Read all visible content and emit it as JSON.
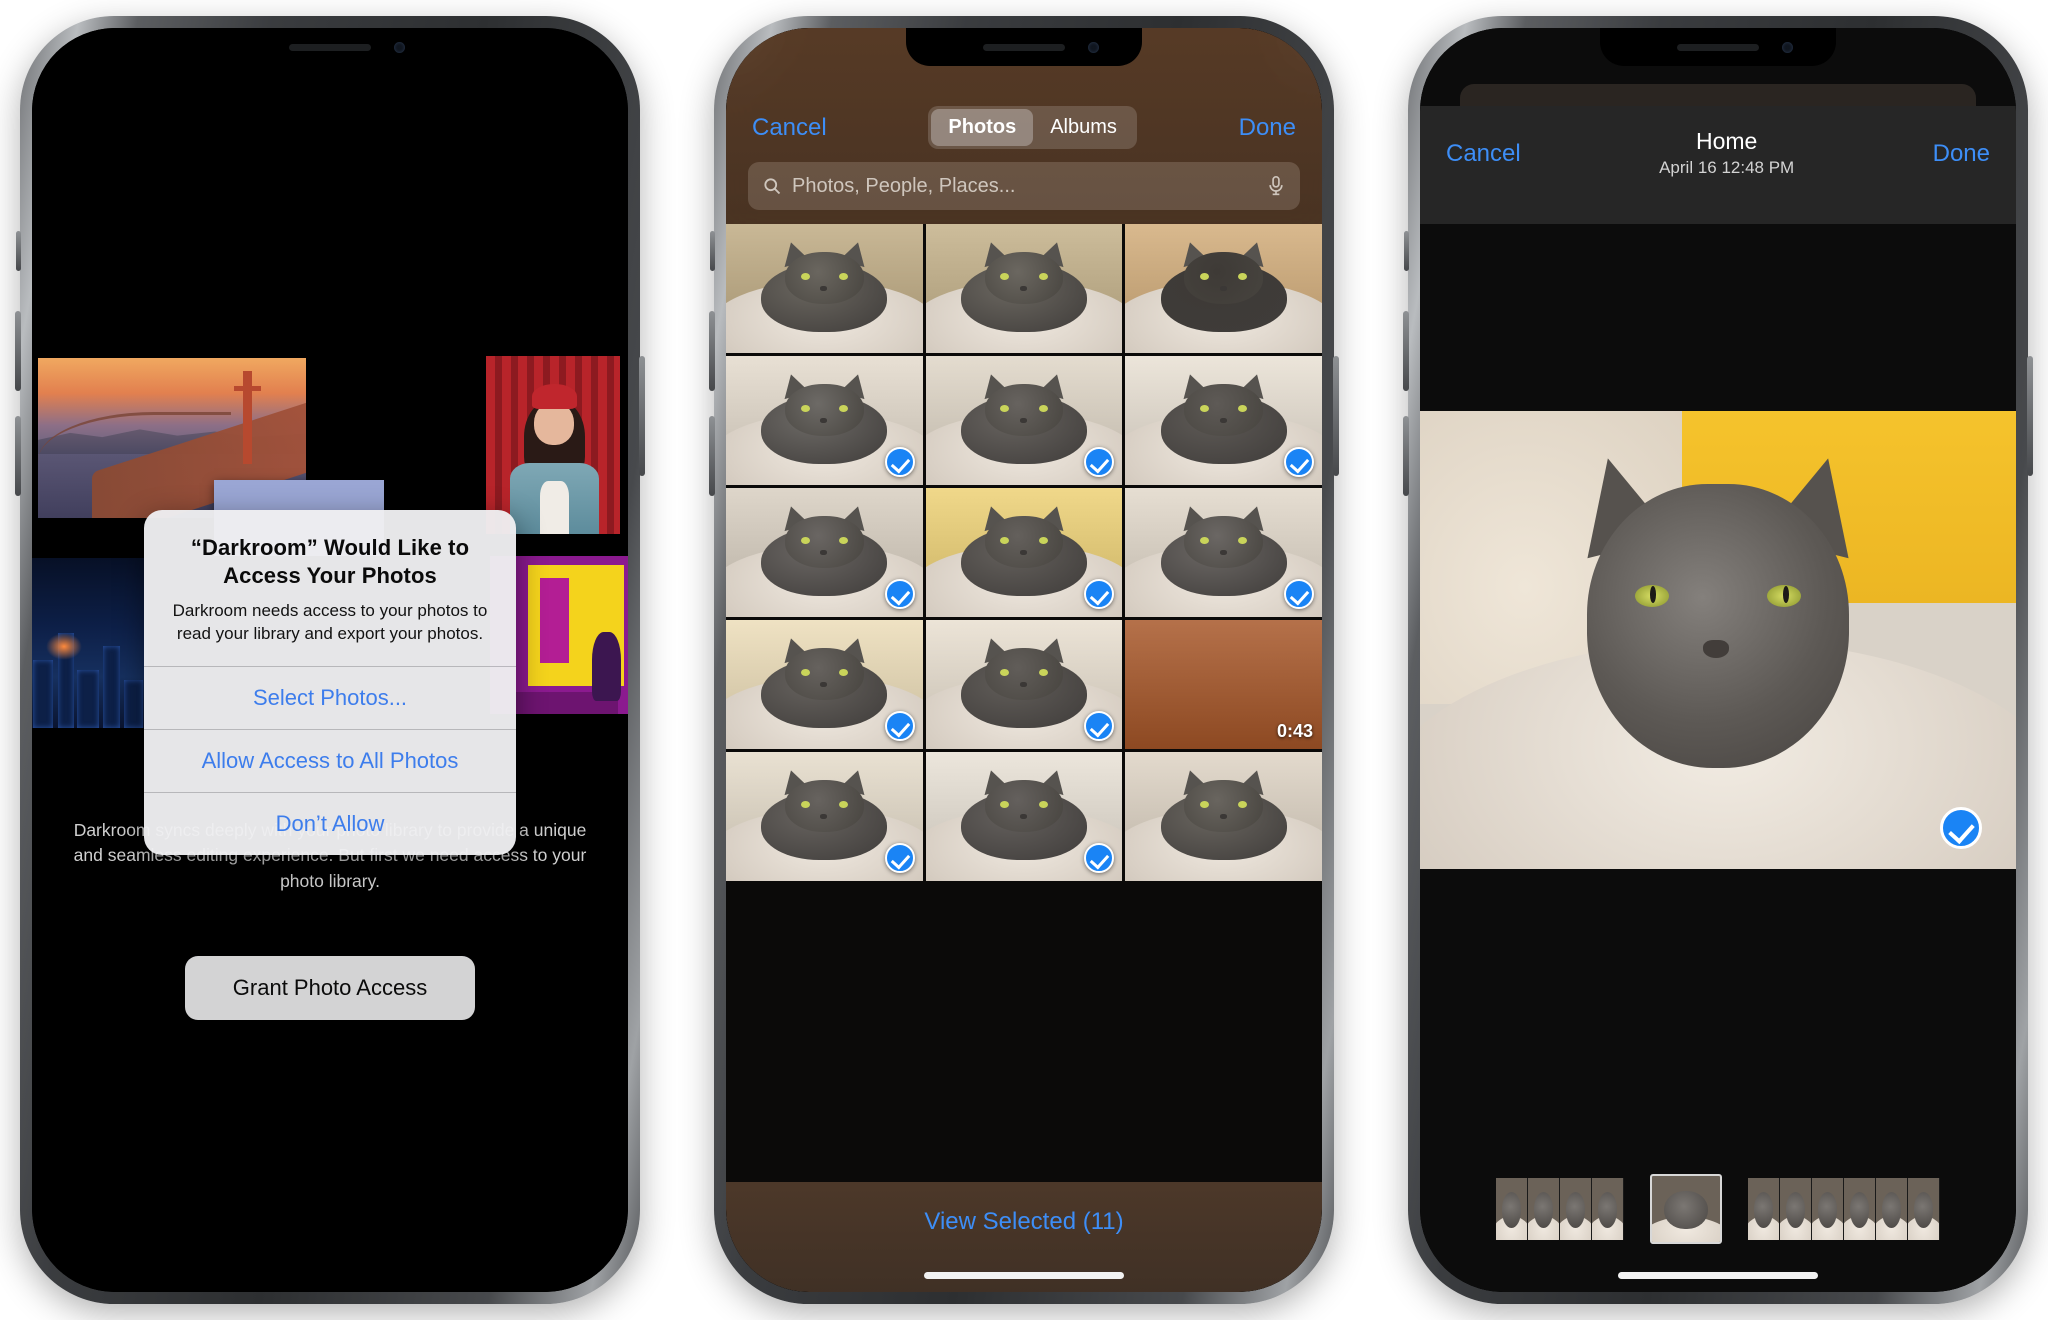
{
  "phone1": {
    "name": "permission-prompt-screen",
    "alert": {
      "title": "“Darkroom” Would Like to Access Your Photos",
      "message": "Darkroom needs access to your photos to read your library and export your photos.",
      "actions": [
        {
          "label": "Select Photos...",
          "style": "normal"
        },
        {
          "label": "Allow Access to All Photos",
          "style": "normal"
        },
        {
          "label": "Don’t Allow",
          "style": "normal"
        }
      ]
    },
    "body_copy": "Darkroom syncs deeply with your photo library to provide a unique and seamless editing experience. But first we need access to your photo library.",
    "cta_label": "Grant Photo Access",
    "collage": [
      {
        "name": "golden-gate-bridge-photo"
      },
      {
        "name": "red-beanie-portrait-photo"
      },
      {
        "name": "blue-card-placeholder"
      },
      {
        "name": "city-night-skyline-photo"
      },
      {
        "name": "pop-art-street-photo"
      }
    ]
  },
  "phone2": {
    "name": "limited-photo-picker-screen",
    "nav": {
      "cancel_label": "Cancel",
      "done_label": "Done",
      "segments": [
        {
          "label": "Photos",
          "selected": true
        },
        {
          "label": "Albums",
          "selected": false
        }
      ]
    },
    "search": {
      "placeholder": "Photos, People, Places...",
      "value": "",
      "search_icon": "search-icon",
      "mic_icon": "microphone-icon"
    },
    "footer": {
      "label": "View Selected (11)",
      "selected_count": 11
    },
    "grid": [
      {
        "id": 1,
        "selected": false,
        "kind": "photo",
        "alt": "cat on windowsill"
      },
      {
        "id": 2,
        "selected": false,
        "kind": "photo",
        "alt": "cat on windowsill"
      },
      {
        "id": 3,
        "selected": false,
        "kind": "photo",
        "alt": "cat lying on tan rug"
      },
      {
        "id": 4,
        "selected": true,
        "kind": "photo",
        "alt": "cat with paw on fluffy bed"
      },
      {
        "id": 5,
        "selected": true,
        "kind": "photo",
        "alt": "cat stretched on fluffy bed"
      },
      {
        "id": 6,
        "selected": true,
        "kind": "photo",
        "alt": "cat curled in donut bed"
      },
      {
        "id": 7,
        "selected": true,
        "kind": "photo",
        "alt": "cat resting head on bed"
      },
      {
        "id": 8,
        "selected": true,
        "kind": "photo",
        "alt": "cat facing camera in bed"
      },
      {
        "id": 9,
        "selected": true,
        "kind": "photo",
        "alt": "cat lying in bed side view"
      },
      {
        "id": 10,
        "selected": true,
        "kind": "photo",
        "alt": "cat sitting in bed"
      },
      {
        "id": 11,
        "selected": true,
        "kind": "photo",
        "alt": "cat curled asleep in bed"
      },
      {
        "id": 12,
        "selected": false,
        "kind": "video",
        "duration": "0:43",
        "alt": "patio chair video"
      },
      {
        "id": 13,
        "selected": true,
        "kind": "photo",
        "alt": "cat closeup"
      },
      {
        "id": 14,
        "selected": true,
        "kind": "photo",
        "alt": "cat closeup"
      },
      {
        "id": 15,
        "selected": false,
        "kind": "photo",
        "alt": "cat closeup"
      }
    ]
  },
  "phone3": {
    "name": "photo-detail-screen",
    "nav": {
      "cancel_label": "Cancel",
      "done_label": "Done",
      "title": "Home",
      "subtitle": "April 16  12:48 PM"
    },
    "photo": {
      "alt": "grey cat resting in fluffy bed against yellow wall",
      "selected": true
    },
    "filmstrip": [
      {
        "group": 1,
        "count": 4,
        "selected": false
      },
      {
        "group": 2,
        "count": 1,
        "selected": true
      },
      {
        "group": 3,
        "count": 6,
        "selected": false
      }
    ]
  },
  "colors": {
    "ios_blue": "#3d8ef7",
    "selection_blue": "#1a84f5",
    "alert_bg": "#eeeef0",
    "toolbar_warm": "#5c3e28",
    "nav_dark": "#262626"
  }
}
